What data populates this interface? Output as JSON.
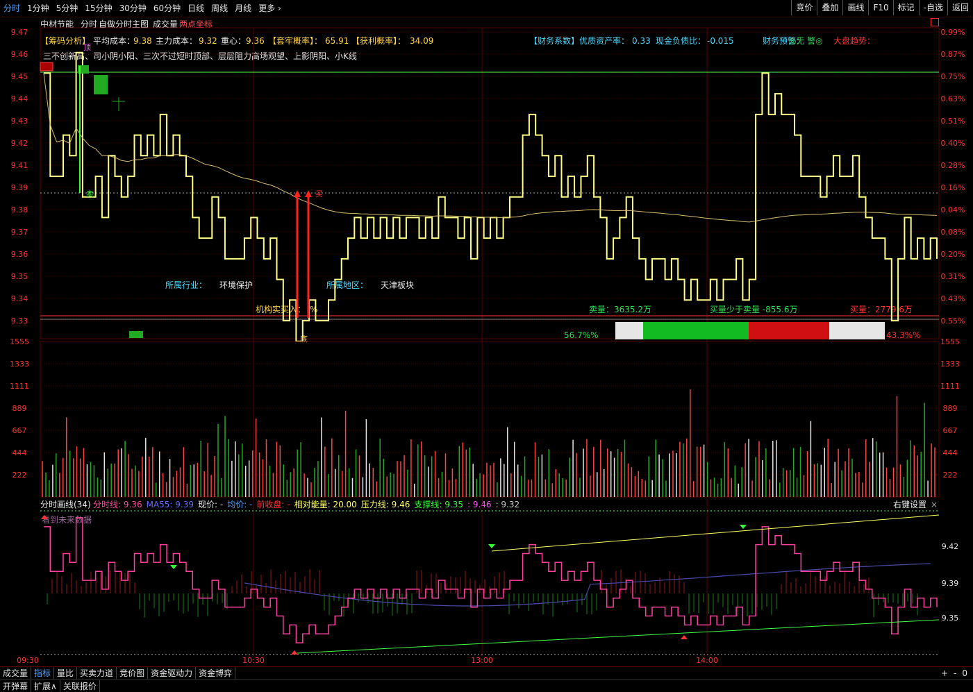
{
  "toolbar": {
    "periods": [
      "分时",
      "1分钟",
      "5分钟",
      "15分钟",
      "30分钟",
      "60分钟",
      "日线",
      "周线",
      "月线",
      "更多 ›"
    ],
    "right": [
      "竞价",
      "叠加",
      "画线",
      "F10",
      "标记",
      "-自选",
      "返回"
    ]
  },
  "main": {
    "stock_name": "中材节能",
    "view": "分时",
    "indicator": "自做分时主图",
    "volume_label": "成交量",
    "two_point": "两点坐标",
    "chip": {
      "label": "【筹码分析】",
      "avg_cost_label": "平均成本：",
      "avg_cost": "9.38",
      "main_cost_label": "主力成本：",
      "main_cost": "9.32",
      "center_label": "重心：",
      "center": "9.36",
      "lock_label": "【套牢概率】：",
      "lock": "65.91",
      "profit_label": "【获利概率】：",
      "profit": "34.09"
    },
    "finance": {
      "label": "【财务系数】",
      "quality_label": "优质资产率：",
      "quality": "0.33",
      "debt_label": "现金负债比：",
      "debt": "-0.015",
      "warn_label": "财务预警：",
      "warn": "◎无 警◎",
      "trend_label": "大盘趋势："
    },
    "signals": "三不创新高、司小阴小阳、三次不过短时顶部、层层阻力高场观望、上影阴阳、小K线",
    "industry_label": "所属行业：",
    "industry": "环境保护",
    "region_label": "所属地区：",
    "region": "天津板块",
    "inst_label": "机构实买入：",
    "inst_val": "%",
    "sell_label": "卖量：3635.2万",
    "diff_label": "买量少于卖量 -855.6万",
    "buy_label": "买量：2779.6万",
    "pct_left": "56.7%%",
    "pct_right": "43.3%%",
    "ratio_buy": 0.567,
    "sig_top": "顶",
    "sig_sell": "卖",
    "sig_buy": "买",
    "sig_bottom": "底",
    "price_ticks": [
      "9.47",
      "9.46",
      "9.45",
      "9.44",
      "9.43",
      "9.42",
      "9.41",
      "9.39",
      "9.38",
      "9.37",
      "9.36",
      "9.35",
      "9.34",
      "9.33"
    ],
    "pct_ticks": [
      "0.99%",
      "0.87%",
      "0.75%",
      "0.63%",
      "0.51%",
      "0.40%",
      "0.28%",
      "0.16%",
      "0.04%",
      "0.08%",
      "0.20%",
      "0.31%",
      "0.43%",
      "0.55%"
    ],
    "vol_ticks": [
      "1555",
      "1333",
      "1111",
      "889",
      "667",
      "444",
      "222"
    ]
  },
  "sub": {
    "title": "分时画线(34)",
    "items": [
      {
        "label": "分时线: ",
        "value": "9.36",
        "color": "#ff4fa0"
      },
      {
        "label": "MA55: ",
        "value": "9.39",
        "color": "#6a6aff"
      },
      {
        "label": "现价: ",
        "value": "-",
        "color": "#e6e6e6"
      },
      {
        "label": "均价: ",
        "value": "-",
        "color": "#4aa3ff"
      },
      {
        "label": "前收盘: ",
        "value": "-",
        "color": "#ff3333"
      },
      {
        "label": "相对能量: ",
        "value": "20.00",
        "color": "#ffff66"
      },
      {
        "label": "压力线: ",
        "value": "9.46",
        "color": "#ffff66"
      },
      {
        "label": "支撑线: ",
        "value": "9.35",
        "color": "#33ff33"
      },
      {
        "label": ": ",
        "value": "9.46",
        "color": "#ff55ff"
      },
      {
        "label": ": ",
        "value": "9.32",
        "color": "#cccccc"
      }
    ],
    "future": "看到未来数据",
    "settings": "右键设置",
    "ticks": [
      "9.42",
      "9.39",
      "9.35"
    ]
  },
  "time_axis": [
    "09:30",
    "10:30",
    "13:00",
    "14:00"
  ],
  "bottom_tabs": [
    "成交量",
    "指标",
    "量比",
    "买卖力道",
    "竞价图",
    "资金驱动力",
    "资金博弈"
  ],
  "bottom_tabs2": [
    "开弹幕",
    "扩展∧",
    "关联报价"
  ],
  "bottom_right": [
    "+",
    "-",
    "0"
  ],
  "colors": {
    "price_line": "#ffff88",
    "avg_line": "#d8c070",
    "grid": "#5a0000",
    "up": "#ff3333",
    "down": "#22aa22"
  },
  "chart_data": {
    "type": "line",
    "price_series": [
      9.45,
      9.4,
      9.4,
      9.42,
      9.41,
      9.46,
      9.39,
      9.39,
      9.4,
      9.38,
      9.41,
      9.4,
      9.39,
      9.4,
      9.42,
      9.41,
      9.42,
      9.41,
      9.43,
      9.41,
      9.42,
      9.41,
      9.4,
      9.38,
      9.37,
      9.37,
      9.39,
      9.38,
      9.36,
      9.36,
      9.36,
      9.37,
      9.38,
      9.37,
      9.36,
      9.37,
      9.35,
      9.33,
      9.34,
      9.32,
      9.33,
      9.34,
      9.33,
      9.33,
      9.34,
      9.35,
      9.36,
      9.37,
      9.38,
      9.37,
      9.38,
      9.37,
      9.38,
      9.37,
      9.38,
      9.37,
      9.38,
      9.38,
      9.37,
      9.38,
      9.37,
      9.39,
      9.38,
      9.38,
      9.37,
      9.38,
      9.36,
      9.38,
      9.37,
      9.38,
      9.37,
      9.38,
      9.39,
      9.39,
      9.42,
      9.43,
      9.42,
      9.41,
      9.4,
      9.41,
      9.39,
      9.4,
      9.39,
      9.4,
      9.41,
      9.39,
      9.38,
      9.36,
      9.37,
      9.38,
      9.39,
      9.37,
      9.36,
      9.35,
      9.36,
      9.36,
      9.35,
      9.36,
      9.35,
      9.34,
      9.35,
      9.34,
      9.34,
      9.35,
      9.34,
      9.35,
      9.35,
      9.36,
      9.34,
      9.35,
      9.43,
      9.45,
      9.43,
      9.44,
      9.43,
      9.43,
      9.42,
      9.4,
      9.4,
      9.4,
      9.39,
      9.4,
      9.41,
      9.4,
      9.4,
      9.41,
      9.39,
      9.38,
      9.37,
      9.37,
      9.36,
      9.33,
      9.36,
      9.38,
      9.36,
      9.37,
      9.36,
      9.37,
      9.36
    ],
    "price_range": [
      9.33,
      9.47
    ],
    "volume_range": [
      0,
      1555
    ]
  }
}
